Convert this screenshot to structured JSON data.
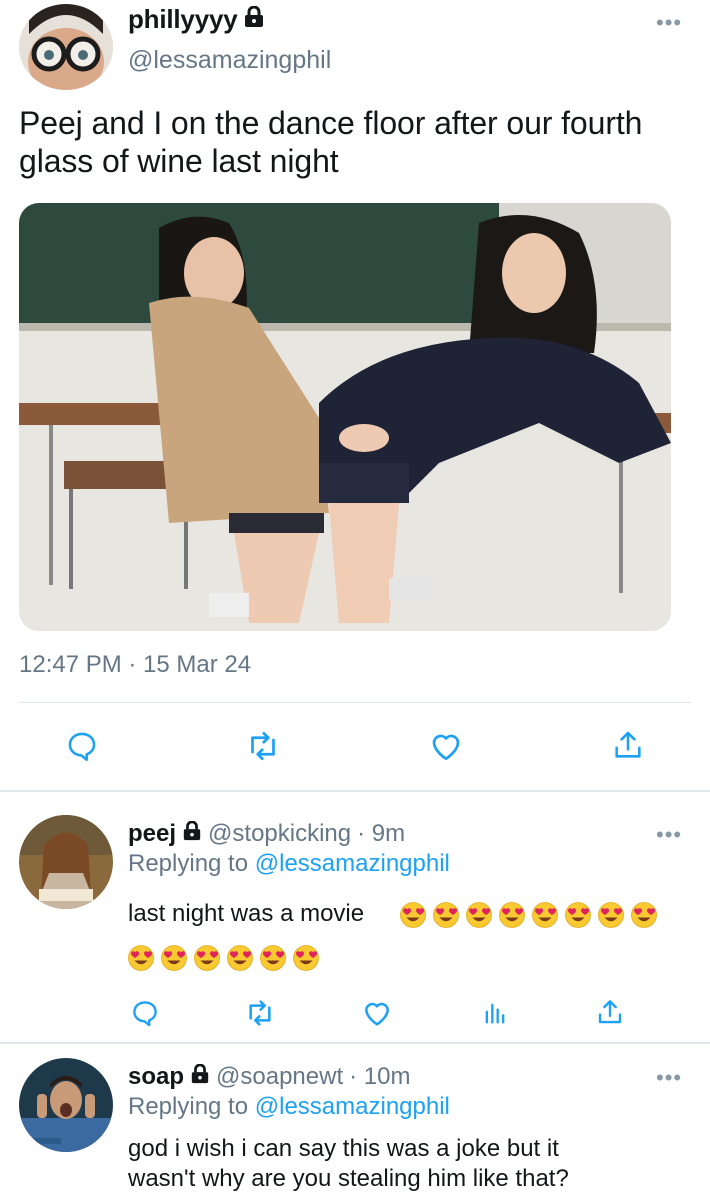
{
  "tweet": {
    "display_name": "phillyyyy",
    "handle": "@lessamazingphil",
    "text": "Peej and I on the dance floor after our fourth glass of wine last night",
    "timestamp": "12:47 PM · 15 Mar 24",
    "locked": true,
    "media_description": "photo of two students in a classroom"
  },
  "replies": [
    {
      "display_name": "peej",
      "handle": "@stopkicking",
      "age": "· 9m",
      "replying_prefix": "Replying to",
      "replying_to": "@lessamazingphil",
      "text": "last night was a movie",
      "emoji_count_line1": 8,
      "emoji_count_line2": 6,
      "emoji": "heart-eyes-emoji"
    },
    {
      "display_name": "soap",
      "handle": "@soapnewt",
      "age": "· 10m",
      "replying_prefix": "Replying to",
      "replying_to": "@lessamazingphil",
      "text_line1": "god i wish i can say this was a joke but it",
      "text_line2": "wasn't why are you stealing him like that?"
    }
  ],
  "colors": {
    "text": "#14171a",
    "secondary": "#657786",
    "link": "#1da1f2",
    "divider": "#e1e8ed",
    "icon": "#1da1f2"
  }
}
